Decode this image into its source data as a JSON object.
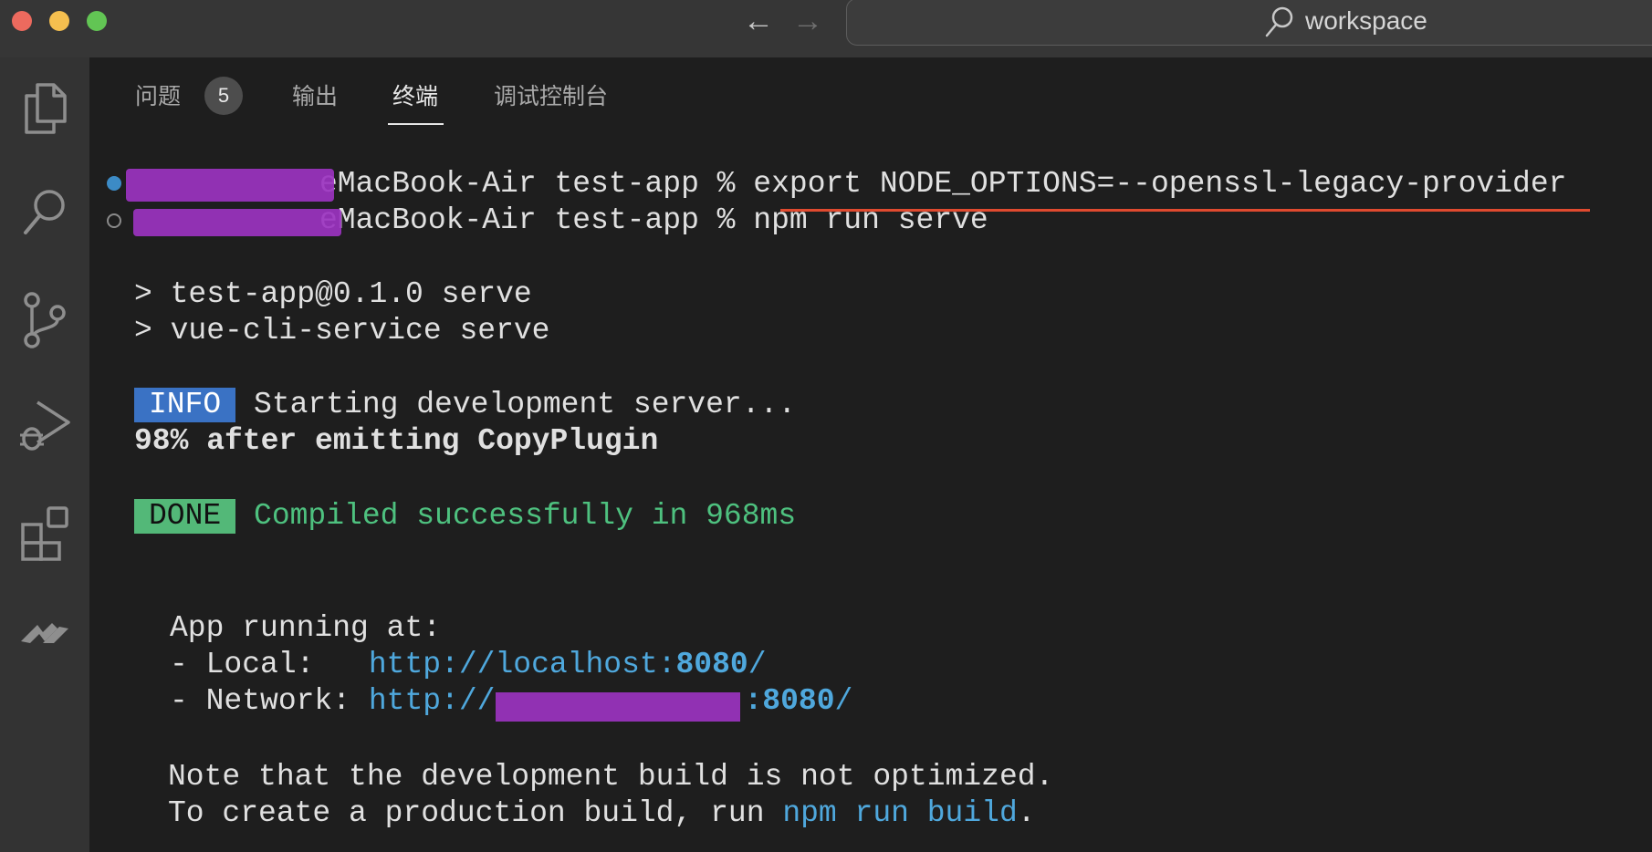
{
  "window": {
    "search_text": "workspace"
  },
  "activity_bar": {
    "icons": [
      "explorer-icon",
      "search-icon",
      "source-control-icon",
      "run-debug-icon",
      "extensions-icon",
      "remote-icon"
    ]
  },
  "panel": {
    "tabs": [
      {
        "label": "问题",
        "badge": "5"
      },
      {
        "label": "输出"
      },
      {
        "label": "终端"
      },
      {
        "label": "调试控制台"
      }
    ],
    "active_tab": "终端"
  },
  "terminal": {
    "line1_host": "eMacBook-Air test-app % ",
    "line1_cmd": "export NODE_OPTIONS=--openssl-legacy-provider",
    "line2_host": "eMacBook-Air test-app % ",
    "line2_cmd": "npm run serve",
    "script1": "> test-app@0.1.0 serve",
    "script2": "> vue-cli-service serve",
    "info_tag": "INFO",
    "info_text": " Starting development server...",
    "progress_text": "98% after emitting CopyPlugin",
    "done_tag": "DONE",
    "done_text": " Compiled successfully in 968ms",
    "app_running": "App running at:",
    "local_label": "- Local:   ",
    "local_url_prefix": "http://localhost:",
    "local_port": "8080",
    "local_slash": "/",
    "network_label": "- Network: ",
    "network_url_prefix": "http://",
    "network_port_sep": ":",
    "network_port": "8080",
    "network_slash": "/",
    "note1": "Note that the development build is not optimized.",
    "note2_prefix": "To create a production build, run ",
    "note2_cmd": "npm run build",
    "note2_suffix": "."
  },
  "colors": {
    "info_bg": "#3a72c4",
    "done_bg": "#53b878",
    "success_text": "#4ec17f",
    "link_text": "#4fa8dd",
    "redaction": "#9b33c0",
    "underline": "#e04a2f"
  }
}
